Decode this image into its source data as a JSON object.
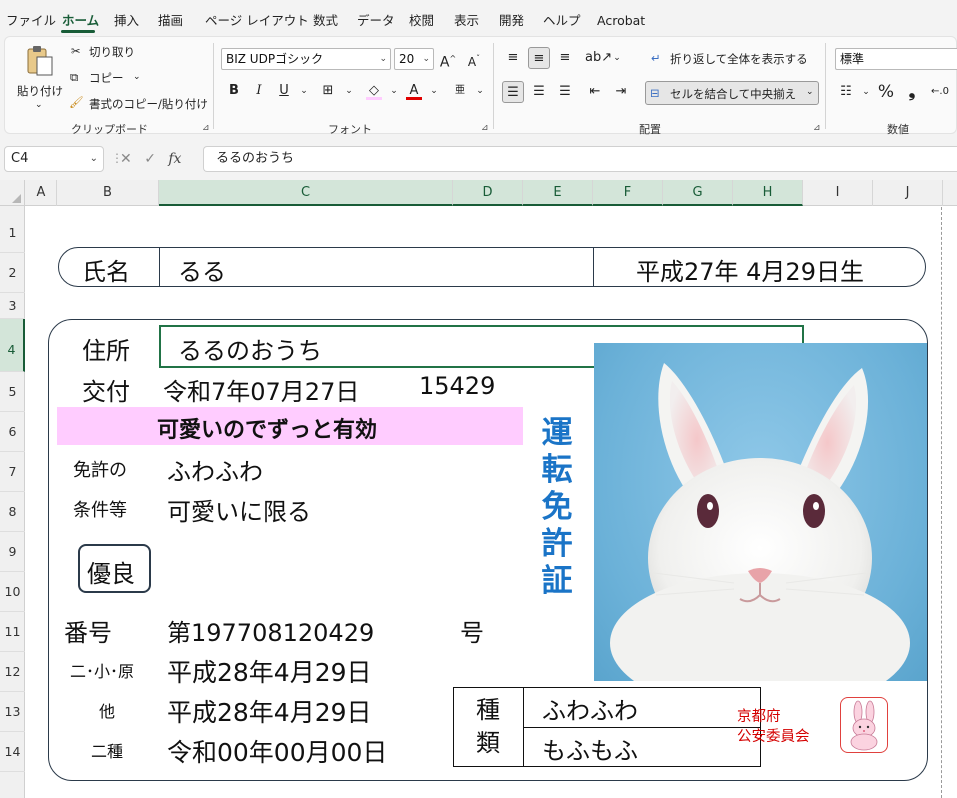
{
  "menu": [
    "ファイル",
    "ホーム",
    "挿入",
    "描画",
    "ページ レイアウト",
    "数式",
    "データ",
    "校閲",
    "表示",
    "開発",
    "ヘルプ",
    "Acrobat"
  ],
  "ribbon": {
    "clipboard": {
      "paste": "貼り付け",
      "cut": "切り取り",
      "copy": "コピー",
      "format_painter": "書式のコピー/貼り付け",
      "group": "クリップボード"
    },
    "font": {
      "name": "BIZ UDPゴシック",
      "size": "20",
      "bold": "B",
      "italic": "I",
      "underline": "U",
      "group": "フォント"
    },
    "alignment": {
      "wrap": "折り返して全体を表示する",
      "merge": "セルを結合して中央揃え",
      "group": "配置"
    },
    "number": {
      "format": "標準",
      "percent": "%",
      "comma": "❟",
      "group": "数値"
    }
  },
  "formula_bar": {
    "cell_ref": "C4",
    "fx": "fx",
    "content": "るるのおうち"
  },
  "columns": [
    "A",
    "B",
    "C",
    "D",
    "E",
    "F",
    "G",
    "H",
    "I",
    "J"
  ],
  "rows": [
    "1",
    "2",
    "3",
    "4",
    "5",
    "6",
    "7",
    "8",
    "9",
    "10",
    "11",
    "12",
    "13",
    "14"
  ],
  "card": {
    "name_label": "氏名",
    "name": "るる",
    "birth": "平成27年  4月29日生",
    "address_label": "住所",
    "address": "るるのおうち",
    "issue_label": "交付",
    "issue_date": "令和7年07月27日",
    "issue_no": "15429",
    "validity": "可愛いのでずっと有効",
    "cond_label1": "免許の",
    "cond_value1": "ふわふわ",
    "cond_label2": "条件等",
    "cond_value2": "可愛いに限る",
    "badge": "優良",
    "license_title": "運転免許証",
    "number_label": "番号",
    "number": "第197708120429",
    "number_suffix": "号",
    "date_label1": "二･小･原",
    "date1": "平成28年4月29日",
    "date_label2": "他",
    "date2": "平成28年4月29日",
    "date_label3": "二種",
    "date3": "令和00年00月00日",
    "kind_label": "種類",
    "kind1": "ふわふわ",
    "kind2": "もふもふ",
    "authority_line1": "京都府",
    "authority_line2": "公安委員会"
  },
  "colors": {
    "accent": "#185c37",
    "title_blue": "#1a74c7",
    "pink": "#ffccff",
    "stamp_red": "#d40000"
  }
}
